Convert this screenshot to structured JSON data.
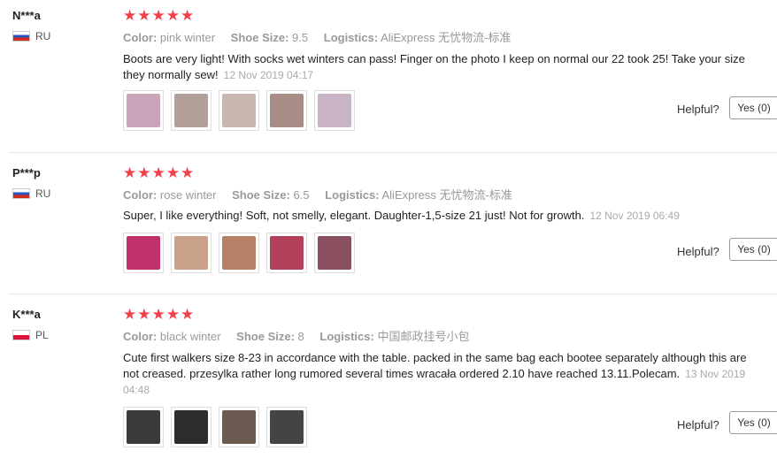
{
  "labels": {
    "color": "Color:",
    "shoe_size": "Shoe Size:",
    "logistics": "Logistics:",
    "helpful": "Helpful?",
    "yes": "Yes (0)"
  },
  "reviews": [
    {
      "user": "N***a",
      "country": "RU",
      "stars": "★★★★★",
      "color": "pink winter",
      "shoe_size": "9.5",
      "logistics": "AliExpress 无忧物流-标准",
      "text": "Boots are very light! With socks wet winters can pass! Finger on the photo I keep on normal our 22 took 25! Take your size they normally sew!",
      "date": "12 Nov 2019 04:17",
      "photo_colors": [
        "#c9a3b8",
        "#b3a09a",
        "#c8b6b0",
        "#a88c86",
        "#c9b4c6"
      ]
    },
    {
      "user": "P***p",
      "country": "RU",
      "stars": "★★★★★",
      "color": "rose winter",
      "shoe_size": "6.5",
      "logistics": "AliExpress 无忧物流-标准",
      "text": "Super, I like everything! Soft, not smelly, elegant. Daughter-1,5-size 21 just! Not for growth.",
      "date": "12 Nov 2019 06:49",
      "photo_colors": [
        "#c0306a",
        "#c9a08a",
        "#b58066",
        "#b2405a",
        "#8a5060"
      ]
    },
    {
      "user": "K***a",
      "country": "PL",
      "stars": "★★★★★",
      "color": "black winter",
      "shoe_size": "8",
      "logistics": "中国邮政挂号小包",
      "text": "Cute first walkers size 8-23 in accordance with the table. packed in the same bag each bootee separately although this are not creased. przesylka rather long rumored several times wracała ordered 2.10 have reached 13.11.Polecam.",
      "date": "13 Nov 2019 04:48",
      "photo_colors": [
        "#3a3a3a",
        "#2c2c2c",
        "#6a5a50",
        "#444444"
      ]
    }
  ]
}
